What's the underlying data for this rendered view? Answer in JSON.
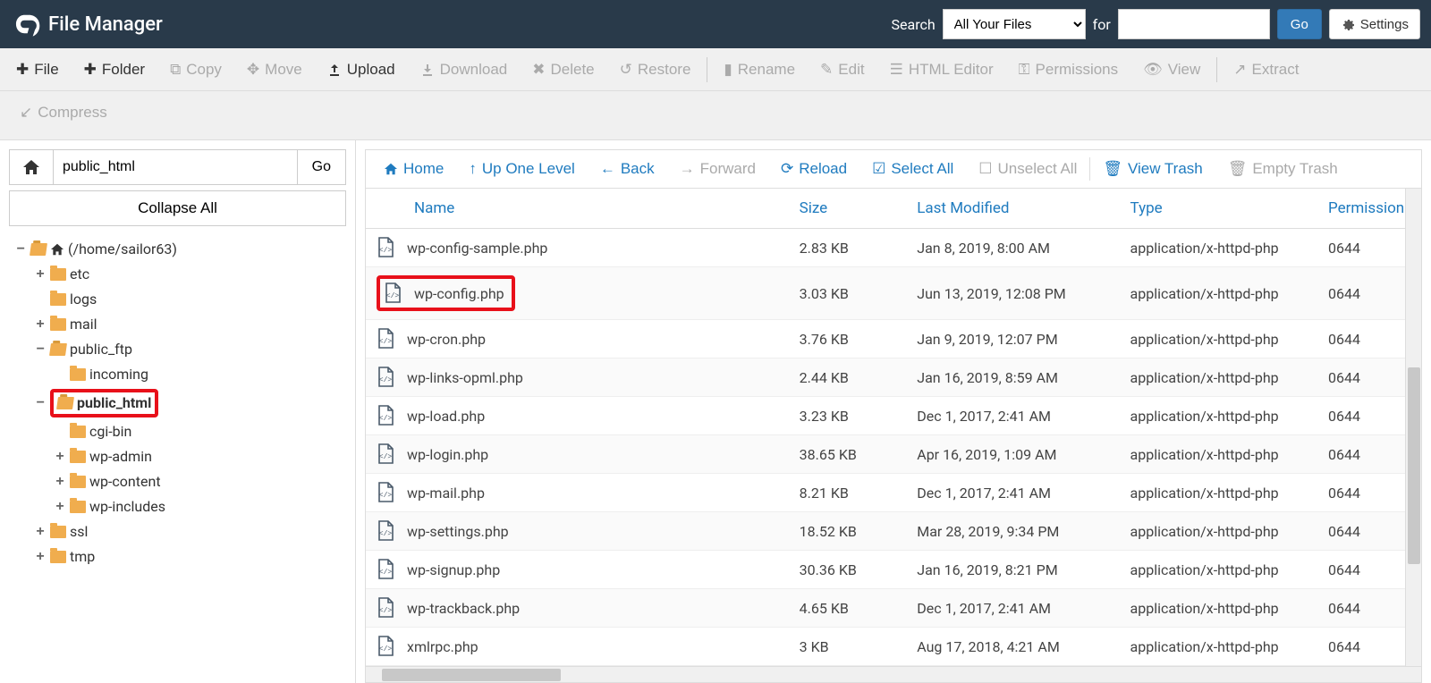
{
  "header": {
    "title": "File Manager",
    "search_label": "Search",
    "search_scope": "All Your Files",
    "for_label": "for",
    "search_value": "",
    "go": "Go",
    "settings": "Settings"
  },
  "toolbar": {
    "file": "File",
    "folder": "Folder",
    "copy": "Copy",
    "move": "Move",
    "upload": "Upload",
    "download": "Download",
    "delete": "Delete",
    "restore": "Restore",
    "rename": "Rename",
    "edit": "Edit",
    "html_editor": "HTML Editor",
    "permissions": "Permissions",
    "view": "View",
    "extract": "Extract",
    "compress": "Compress"
  },
  "sidebar": {
    "path": "public_html",
    "go": "Go",
    "collapse_all": "Collapse All",
    "root_label": "(/home/sailor63)",
    "tree": [
      {
        "label": "etc",
        "expander": "+",
        "open": false,
        "depth": 1
      },
      {
        "label": "logs",
        "expander": "",
        "open": false,
        "depth": 1
      },
      {
        "label": "mail",
        "expander": "+",
        "open": false,
        "depth": 1
      },
      {
        "label": "public_ftp",
        "expander": "−",
        "open": true,
        "depth": 1
      },
      {
        "label": "incoming",
        "expander": "",
        "open": false,
        "depth": 2
      },
      {
        "label": "public_html",
        "expander": "−",
        "open": true,
        "depth": 1,
        "highlight": true,
        "bold": true
      },
      {
        "label": "cgi-bin",
        "expander": "",
        "open": false,
        "depth": 2
      },
      {
        "label": "wp-admin",
        "expander": "+",
        "open": false,
        "depth": 2
      },
      {
        "label": "wp-content",
        "expander": "+",
        "open": false,
        "depth": 2
      },
      {
        "label": "wp-includes",
        "expander": "+",
        "open": false,
        "depth": 2
      },
      {
        "label": "ssl",
        "expander": "+",
        "open": false,
        "depth": 1
      },
      {
        "label": "tmp",
        "expander": "+",
        "open": false,
        "depth": 1
      }
    ]
  },
  "content_toolbar": {
    "home": "Home",
    "up": "Up One Level",
    "back": "Back",
    "forward": "Forward",
    "reload": "Reload",
    "select_all": "Select All",
    "unselect_all": "Unselect All",
    "view_trash": "View Trash",
    "empty_trash": "Empty Trash"
  },
  "columns": {
    "name": "Name",
    "size": "Size",
    "modified": "Last Modified",
    "type": "Type",
    "permissions": "Permissions"
  },
  "files": [
    {
      "name": "wp-config-sample.php",
      "size": "2.83 KB",
      "modified": "Jan 8, 2019, 8:00 AM",
      "type": "application/x-httpd-php",
      "perm": "0644"
    },
    {
      "name": "wp-config.php",
      "size": "3.03 KB",
      "modified": "Jun 13, 2019, 12:08 PM",
      "type": "application/x-httpd-php",
      "perm": "0644",
      "highlight": true
    },
    {
      "name": "wp-cron.php",
      "size": "3.76 KB",
      "modified": "Jan 9, 2019, 12:07 PM",
      "type": "application/x-httpd-php",
      "perm": "0644"
    },
    {
      "name": "wp-links-opml.php",
      "size": "2.44 KB",
      "modified": "Jan 16, 2019, 8:59 AM",
      "type": "application/x-httpd-php",
      "perm": "0644"
    },
    {
      "name": "wp-load.php",
      "size": "3.23 KB",
      "modified": "Dec 1, 2017, 2:41 AM",
      "type": "application/x-httpd-php",
      "perm": "0644"
    },
    {
      "name": "wp-login.php",
      "size": "38.65 KB",
      "modified": "Apr 16, 2019, 1:09 AM",
      "type": "application/x-httpd-php",
      "perm": "0644"
    },
    {
      "name": "wp-mail.php",
      "size": "8.21 KB",
      "modified": "Dec 1, 2017, 2:41 AM",
      "type": "application/x-httpd-php",
      "perm": "0644"
    },
    {
      "name": "wp-settings.php",
      "size": "18.52 KB",
      "modified": "Mar 28, 2019, 9:34 PM",
      "type": "application/x-httpd-php",
      "perm": "0644"
    },
    {
      "name": "wp-signup.php",
      "size": "30.36 KB",
      "modified": "Jan 16, 2019, 8:21 PM",
      "type": "application/x-httpd-php",
      "perm": "0644"
    },
    {
      "name": "wp-trackback.php",
      "size": "4.65 KB",
      "modified": "Dec 1, 2017, 2:41 AM",
      "type": "application/x-httpd-php",
      "perm": "0644"
    },
    {
      "name": "xmlrpc.php",
      "size": "3 KB",
      "modified": "Aug 17, 2018, 4:21 AM",
      "type": "application/x-httpd-php",
      "perm": "0644"
    }
  ]
}
